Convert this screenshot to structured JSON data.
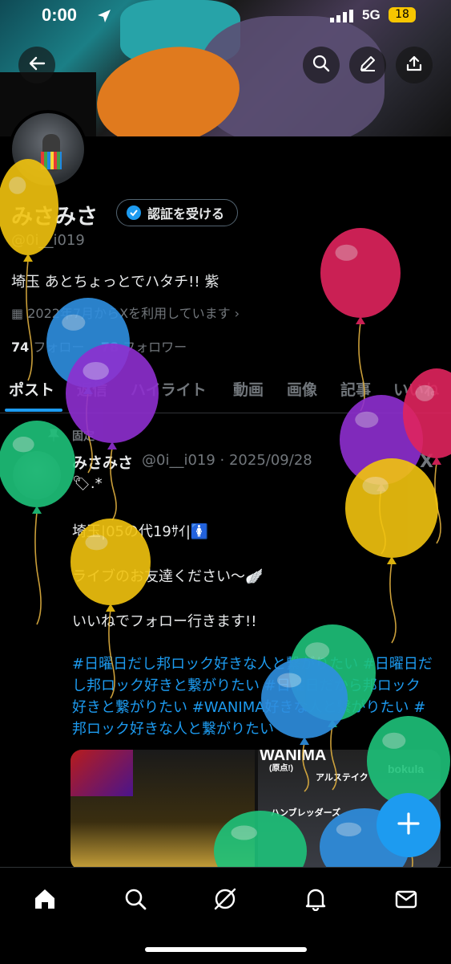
{
  "status_bar": {
    "time": "0:00",
    "network": "5G",
    "battery": "18"
  },
  "header": {
    "back_icon": "arrow-left-icon",
    "search_icon": "search-icon",
    "edit_icon": "pencil-icon",
    "share_icon": "share-icon"
  },
  "profile": {
    "name": "みさみさ",
    "verify_label": "認証を受ける",
    "handle": "@0i__i019",
    "bio": "埼玉 あとちょっとでハタチ!! 紫",
    "joined": "2022年7月からXを利用しています",
    "following_count": "74",
    "following_label": "フォロー",
    "followers_count": "78",
    "followers_label": "フォロワー"
  },
  "tabs": [
    {
      "label": "ポスト",
      "active": true
    },
    {
      "label": "返信"
    },
    {
      "label": "ハイライト"
    },
    {
      "label": "動画"
    },
    {
      "label": "画像"
    },
    {
      "label": "記事"
    },
    {
      "label": "いいね"
    }
  ],
  "post": {
    "pinned_label": "固定",
    "author_name": "みさみさ",
    "meta": "@0i__i019 · 2025/09/28",
    "x_logo": "X",
    "line1": "🏷.*",
    "line2": "埼玉|05の代19ｻｲ|🚺",
    "line3": "ライブのお友達ください〜🪽",
    "line4": "いいねでフォロー行きます!!",
    "hashtags": "#日曜日だし邦ロック好きな人と繋がりたい #日曜日だし邦ロック好きと繋がりたい #日曜日だから邦ロック好きと繋がりたい #WANIMA好きな人と繋がりたい #邦ロック好きな人と繋がりたい",
    "media_labels": {
      "wanima": "WANIMA",
      "wanima_sub": "(原点!)",
      "artist1": "アルステイク",
      "artist2": "ハンブレッダーズ",
      "artist3": "bokula"
    }
  },
  "fab_icon": "plus-icon",
  "bottom_nav": [
    "home-icon",
    "search-icon",
    "grok-icon",
    "bell-icon",
    "mail-icon"
  ],
  "colors": {
    "accent": "#1d9bf0",
    "background": "#000000",
    "muted": "#71767b",
    "text": "#e7e9ea"
  }
}
